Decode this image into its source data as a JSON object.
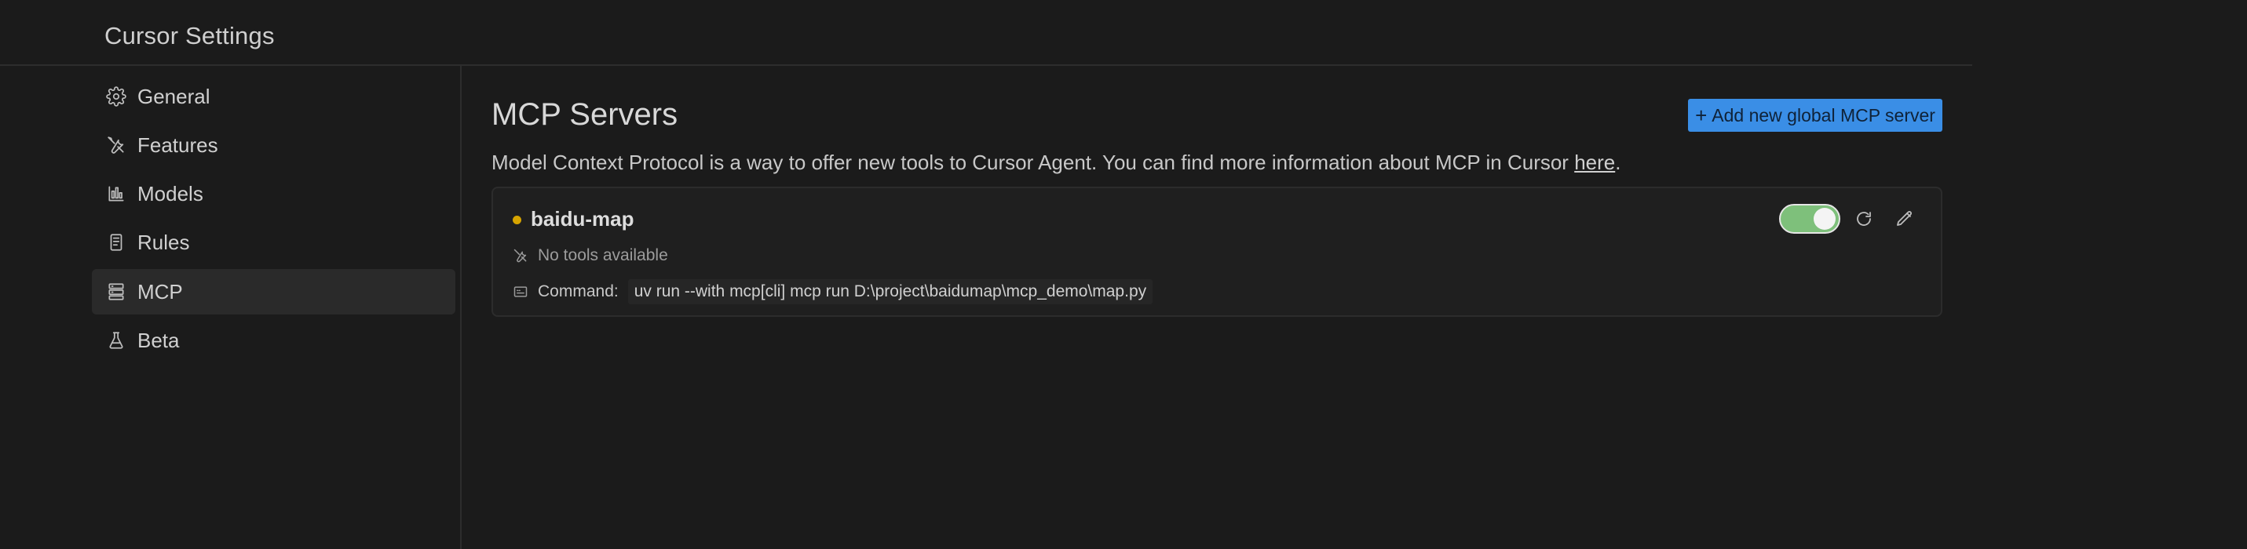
{
  "window": {
    "title": "Cursor Settings"
  },
  "sidebar": {
    "items": [
      {
        "label": "General",
        "icon": "gear-icon"
      },
      {
        "label": "Features",
        "icon": "tools-icon"
      },
      {
        "label": "Models",
        "icon": "bar-chart-icon"
      },
      {
        "label": "Rules",
        "icon": "book-icon"
      },
      {
        "label": "MCP",
        "icon": "server-stack-icon",
        "active": true
      },
      {
        "label": "Beta",
        "icon": "flask-icon"
      }
    ]
  },
  "main": {
    "title": "MCP Servers",
    "add_button_label": "Add new global MCP server",
    "description_text": "Model Context Protocol is a way to offer new tools to Cursor Agent. You can find more information about MCP in Cursor ",
    "description_link": "here",
    "description_end": ".",
    "servers": [
      {
        "name": "baidu-map",
        "status_color": "#d6a400",
        "tools_text": "No tools available",
        "command_label": "Command:",
        "command_value": "uv run --with mcp[cli] mcp run D:\\project\\baidumap\\mcp_demo\\map.py",
        "enabled": true
      }
    ]
  },
  "colors": {
    "background": "#1b1b1b",
    "accent": "#3a8ee6",
    "toggle_on": "#7ec07b"
  }
}
